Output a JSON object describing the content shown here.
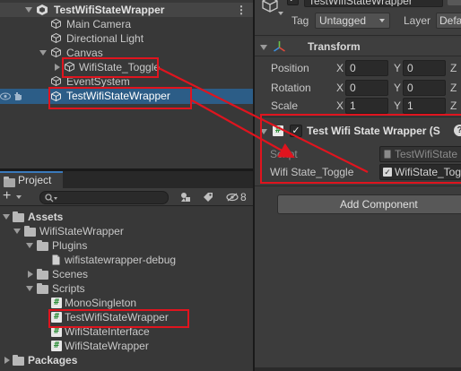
{
  "hierarchy": {
    "scene_name": "TestWifiStateWrapper",
    "items": [
      {
        "label": "Main Camera"
      },
      {
        "label": "Directional Light"
      },
      {
        "label": "Canvas"
      },
      {
        "label": "WifiState_Toggle"
      },
      {
        "label": "EventSystem"
      },
      {
        "label": "TestWifiStateWrapper"
      }
    ]
  },
  "project": {
    "tab_label": "Project",
    "add_label": "+",
    "hidden_count": "8",
    "tree": [
      {
        "label": "Assets"
      },
      {
        "label": "WifiStateWrapper"
      },
      {
        "label": "Plugins"
      },
      {
        "label": "wifistatewrapper-debug"
      },
      {
        "label": "Scenes"
      },
      {
        "label": "Scripts"
      },
      {
        "label": "MonoSingleton"
      },
      {
        "label": "TestWifiStateWrapper"
      },
      {
        "label": "WifiStateInterface"
      },
      {
        "label": "WifiStateWrapper"
      },
      {
        "label": "Packages"
      }
    ]
  },
  "inspector": {
    "object_name": "TestWifiStateWrapper",
    "tag_label": "Tag",
    "tag_value": "Untagged",
    "layer_label": "Layer",
    "layer_value": "Defa",
    "transform": {
      "title": "Transform",
      "position_label": "Position",
      "rotation_label": "Rotation",
      "scale_label": "Scale",
      "axis_x": "X",
      "axis_y": "Y",
      "axis_z": "Z",
      "position": [
        "0",
        "0"
      ],
      "rotation": [
        "0",
        "0"
      ],
      "scale": [
        "1",
        "1"
      ]
    },
    "component": {
      "title": "Test Wifi State Wrapper (S",
      "script_label": "Script",
      "script_value": "TestWifiState",
      "field_label": "Wifi State_Toggle",
      "field_value": "WifiState_Tog"
    },
    "add_component_label": "Add Component"
  },
  "colors": {
    "selection": "#2c5d87",
    "annotation_red": "#e0141e",
    "panel_bg": "#383838",
    "inspector_bg": "#3c3c3c"
  }
}
